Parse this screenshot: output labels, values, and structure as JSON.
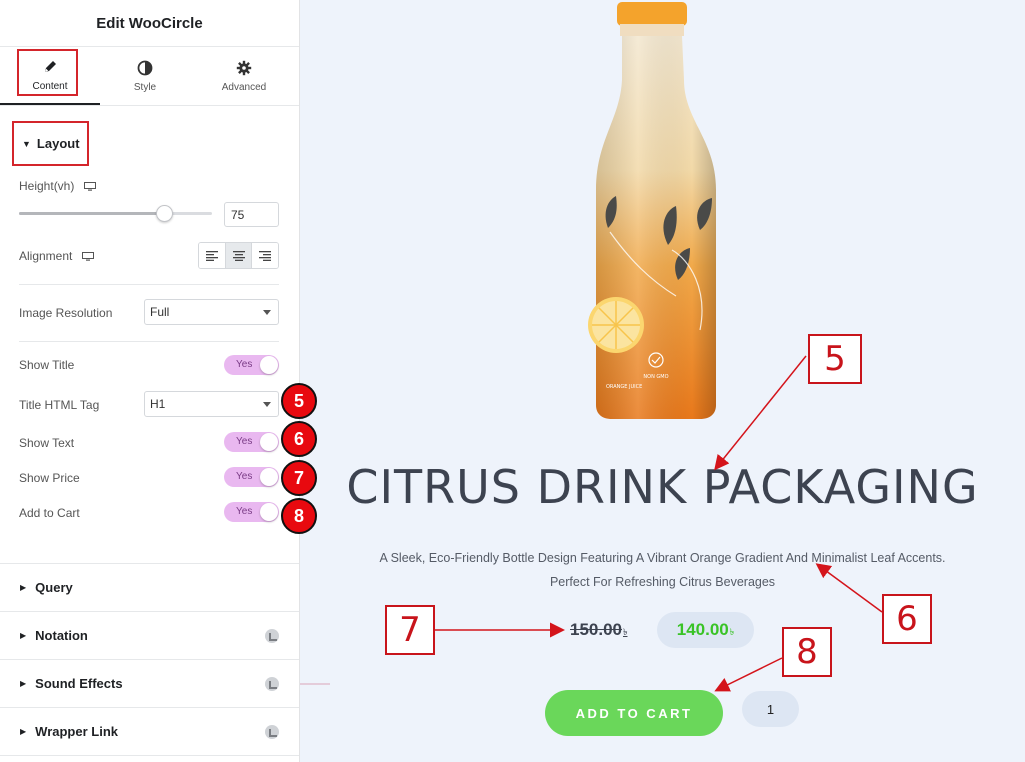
{
  "panel": {
    "title": "Edit WooCircle",
    "tabs": [
      {
        "label": "Content",
        "icon": "pencil-icon"
      },
      {
        "label": "Style",
        "icon": "half-circle-icon"
      },
      {
        "label": "Advanced",
        "icon": "gear-icon"
      }
    ],
    "layout": {
      "heading": "Layout",
      "height_label": "Height(vh)",
      "height_value": "75",
      "height_fraction": 0.75,
      "alignment_label": "Alignment",
      "alignment_selected": "center",
      "image_resolution_label": "Image Resolution",
      "image_resolution_value": "Full",
      "show_title_label": "Show Title",
      "title_tag_label": "Title HTML Tag",
      "title_tag_value": "H1",
      "show_text_label": "Show Text",
      "show_price_label": "Show Price",
      "add_to_cart_label": "Add to Cart",
      "switch_on_text": "Yes"
    },
    "sections": [
      "Query",
      "Notation",
      "Sound Effects",
      "Wrapper Link"
    ],
    "badges": [
      "5",
      "6",
      "7",
      "8"
    ],
    "accent": "#e9b8f0"
  },
  "preview": {
    "title": "CITRUS DRINK PACKAGING",
    "description_line1": "A Sleek, Eco-Friendly Bottle Design Featuring A Vibrant Orange Gradient And Minimalist Leaf Accents.",
    "description_line2": "Perfect For Refreshing Citrus Beverages",
    "old_price": "150.00",
    "new_price": "140.00",
    "currency": "৳",
    "add_to_cart": "ADD TO CART",
    "quantity": "1",
    "bottle_label_1": "NON GMO",
    "bottle_label_2": "ORANGE JUICE",
    "price_color": "#39c326",
    "button_color": "#6ad75a"
  },
  "callouts": [
    "5",
    "6",
    "7",
    "8"
  ]
}
